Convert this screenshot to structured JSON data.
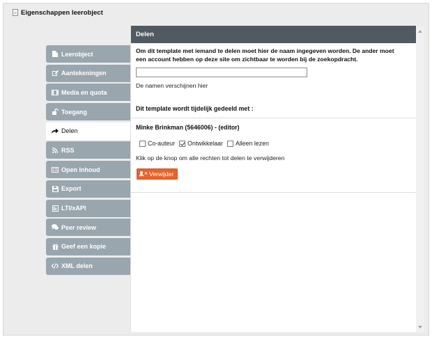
{
  "window": {
    "title": "Eigenschappen leerobject",
    "icon": "document-icon"
  },
  "sidebar": {
    "items": [
      {
        "label": "Leerobject",
        "icon": "file-icon",
        "active": false
      },
      {
        "label": "Aantekeningen",
        "icon": "pencil-icon",
        "active": false
      },
      {
        "label": "Media en quota",
        "icon": "film-icon",
        "active": false
      },
      {
        "label": "Toegang",
        "icon": "unlock-icon",
        "active": false
      },
      {
        "label": "Delen",
        "icon": "share-icon",
        "active": true
      },
      {
        "label": "RSS",
        "icon": "rss-icon",
        "active": false
      },
      {
        "label": "Open Inhoud",
        "icon": "open-content-icon",
        "active": false
      },
      {
        "label": "Export",
        "icon": "save-icon",
        "active": false
      },
      {
        "label": "LTI/xAPI",
        "icon": "lti-icon",
        "active": false
      },
      {
        "label": "Peer review",
        "icon": "comments-icon",
        "active": false
      },
      {
        "label": "Geef een kopie",
        "icon": "gift-icon",
        "active": false
      },
      {
        "label": "XML delen",
        "icon": "code-icon",
        "active": false
      }
    ]
  },
  "panel": {
    "header": "Delen",
    "intro": "Om dit template met iemand te delen moet hier de naam ingegeven worden. De ander moet een account hebben op deze site om zichtbaar te worden bij de zoekopdracht.",
    "name_input": {
      "value": "",
      "placeholder": ""
    },
    "hint": "De namen verschijnen hier",
    "shared_title": "Dit template wordt tijdelijk gedeeld met :",
    "owner": "Minke Brinkman (5646006) - (editor)",
    "permissions": [
      {
        "label": "Co-auteur",
        "checked": false
      },
      {
        "label": "Ontwikkelaar",
        "checked": true
      },
      {
        "label": "Alleen lezen",
        "checked": false
      }
    ],
    "remove_text": "Klik op de knop om alle rechten tot delen te verwijderen",
    "remove_button": {
      "label": "Verwijder",
      "icon": "user-remove-icon"
    }
  },
  "colors": {
    "header_bg": "#505a60",
    "sidebar_bg": "#9aa6ae",
    "button_bg": "#e8642c",
    "window_bg": "#ececec"
  }
}
